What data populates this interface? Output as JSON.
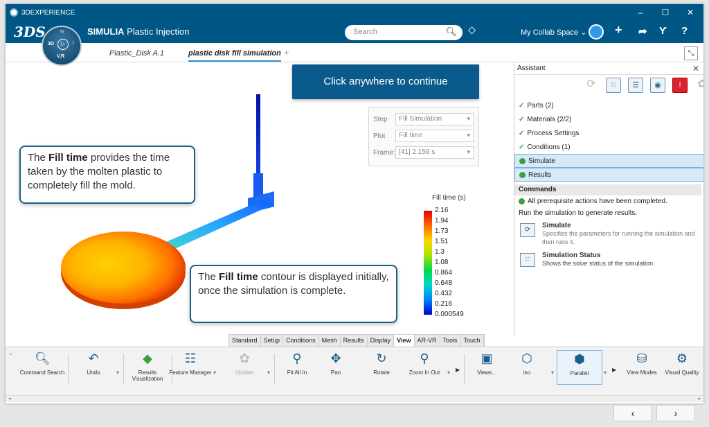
{
  "window": {
    "title": "3DEXPERIENCE",
    "controls": [
      "–",
      "☐",
      "✕"
    ]
  },
  "topbar": {
    "brand_prefix": "SIMULIA",
    "brand_app": "Plastic Injection",
    "compass": {
      "yr": "Yr",
      "three_d": "3D",
      "i": "i",
      "vr": "V,R"
    },
    "search_placeholder": "Search",
    "collab_space": "My Collab Space ⌄",
    "icons": [
      "tag-icon",
      "plus-icon",
      "share-icon",
      "tools-icon",
      "help-icon"
    ]
  },
  "tabs": [
    {
      "label": "Plastic_Disk A.1",
      "active": false
    },
    {
      "label": "plastic disk fill simulation",
      "active": true
    }
  ],
  "tabs_add": "+",
  "viewport": {
    "toast": "Click anywhere to continue",
    "callout1": {
      "pre": "The ",
      "bold": "Fill time",
      "post": " provides the time taken by the molten plastic to completely fill the mold."
    },
    "callout2": {
      "pre": "The ",
      "bold": "Fill time",
      "post": " contour is displayed initially, once the simulation is complete."
    },
    "selector": {
      "step_label": "Step",
      "step_value": "Fill Simulation",
      "plot_label": "Plot",
      "plot_value": "Fill time",
      "frame_label": "Frame:",
      "frame_value": "[41]   2.159 s"
    },
    "legend": {
      "title": "Fill time (s)",
      "values": [
        "2.16",
        "1.94",
        "1.73",
        "1.51",
        "1.3",
        "1.08",
        "0.864",
        "0.648",
        "0.432",
        "0.216",
        "0.000549"
      ]
    }
  },
  "assistant": {
    "title": "Assistant",
    "steps": [
      {
        "label": "Parts (2)",
        "status": "done"
      },
      {
        "label": "Materials (2/2)",
        "status": "done"
      },
      {
        "label": "Process Settings",
        "status": "done"
      },
      {
        "label": "Conditions (1)",
        "status": "done"
      },
      {
        "label": "Simulate",
        "status": "active"
      },
      {
        "label": "Results",
        "status": "active"
      }
    ],
    "commands_header": "Commands",
    "prereq": "All prerequisite actions have been completed.",
    "run_text": "Run the simulation to generate results.",
    "cmd1": {
      "title": "Simulate",
      "desc": "Specifies the parameters for running the simulation and then runs it."
    },
    "cmd2": {
      "title": "Simulation Status",
      "desc": "Shows the solve status of the simulation."
    }
  },
  "tooltabs": [
    "Standard",
    "Setup",
    "Conditions",
    "Mesh",
    "Results",
    "Display",
    "View",
    "AR-VR",
    "Tools",
    "Touch"
  ],
  "tools": {
    "command_search": "Command Search",
    "undo": "Undo",
    "results_visualization": "Results Visualization",
    "feature_manager": "Feature Manager",
    "update": "Update",
    "fit_all_in": "Fit All In",
    "pan": "Pan",
    "rotate": "Rotate",
    "zoom": "Zoom In Out",
    "views": "Views...",
    "iso": "iso",
    "parallel": "Parallel",
    "view_modes": "View Modes",
    "visual_quality": "Visual Quality"
  },
  "nav": {
    "prev": "‹",
    "next": "›"
  }
}
